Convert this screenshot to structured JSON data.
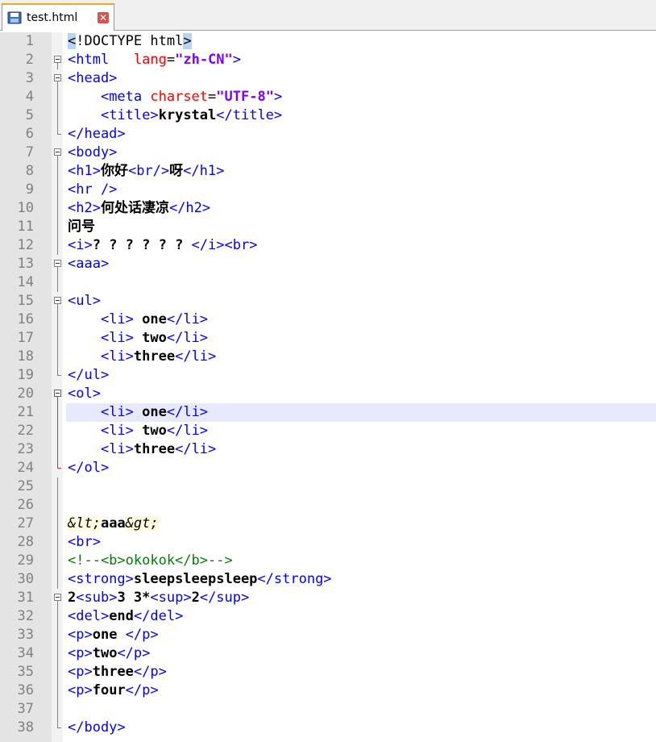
{
  "tab": {
    "title": "test.html",
    "close": "✕"
  },
  "icons": {
    "file": "save-disk-icon",
    "close": "close-icon"
  },
  "current_line": 21,
  "lines": [
    {
      "n": "1",
      "fold": "",
      "tokens": [
        [
          "hl",
          "<"
        ],
        [
          "plain",
          "!DOCTYPE html"
        ],
        [
          "hl",
          ">"
        ]
      ]
    },
    {
      "n": "2",
      "fold": "open",
      "tokens": [
        [
          "tag",
          "<html"
        ],
        [
          "plain",
          "   "
        ],
        [
          "attr",
          "lang"
        ],
        [
          "plain",
          "="
        ],
        [
          "val",
          "\"zh-CN\""
        ],
        [
          "tag",
          ">"
        ]
      ]
    },
    {
      "n": "3",
      "fold": "open",
      "tokens": [
        [
          "tag",
          "<head>"
        ]
      ]
    },
    {
      "n": "4",
      "fold": "line",
      "tokens": [
        [
          "plain",
          "    "
        ],
        [
          "tag",
          "<meta "
        ],
        [
          "attr",
          "charset"
        ],
        [
          "plain",
          "="
        ],
        [
          "val",
          "\"UTF-8\""
        ],
        [
          "tag",
          ">"
        ]
      ]
    },
    {
      "n": "5",
      "fold": "line",
      "tokens": [
        [
          "plain",
          "    "
        ],
        [
          "tag",
          "<title>"
        ],
        [
          "txt",
          "krystal"
        ],
        [
          "tag",
          "</title>"
        ]
      ]
    },
    {
      "n": "6",
      "fold": "end",
      "tokens": [
        [
          "tag",
          "</head>"
        ]
      ]
    },
    {
      "n": "7",
      "fold": "open",
      "tokens": [
        [
          "tag",
          "<body>"
        ]
      ]
    },
    {
      "n": "8",
      "fold": "line",
      "tokens": [
        [
          "tag",
          "<h1>"
        ],
        [
          "txt",
          "你好"
        ],
        [
          "tag",
          "<br/>"
        ],
        [
          "txt",
          "呀"
        ],
        [
          "tag",
          "</h1>"
        ]
      ]
    },
    {
      "n": "9",
      "fold": "line",
      "tokens": [
        [
          "tag",
          "<hr />"
        ]
      ]
    },
    {
      "n": "10",
      "fold": "line",
      "tokens": [
        [
          "tag",
          "<h2>"
        ],
        [
          "txt",
          "何处话凄凉"
        ],
        [
          "tag",
          "</h2>"
        ]
      ]
    },
    {
      "n": "11",
      "fold": "line",
      "tokens": [
        [
          "txt",
          "问号"
        ]
      ]
    },
    {
      "n": "12",
      "fold": "line",
      "tokens": [
        [
          "tag",
          "<i>"
        ],
        [
          "txt",
          "? ? ? ? ? ? "
        ],
        [
          "tag",
          "</i><br>"
        ]
      ]
    },
    {
      "n": "13",
      "fold": "open",
      "tokens": [
        [
          "tag",
          "<aaa>"
        ]
      ]
    },
    {
      "n": "14",
      "fold": "line",
      "tokens": []
    },
    {
      "n": "15",
      "fold": "open",
      "tokens": [
        [
          "tag",
          "<ul>"
        ]
      ]
    },
    {
      "n": "16",
      "fold": "line",
      "tokens": [
        [
          "plain",
          "    "
        ],
        [
          "tag",
          "<li> "
        ],
        [
          "txt",
          "one"
        ],
        [
          "tag",
          "</li>"
        ]
      ]
    },
    {
      "n": "17",
      "fold": "line",
      "tokens": [
        [
          "plain",
          "    "
        ],
        [
          "tag",
          "<li> "
        ],
        [
          "txt",
          "two"
        ],
        [
          "tag",
          "</li>"
        ]
      ]
    },
    {
      "n": "18",
      "fold": "line",
      "tokens": [
        [
          "plain",
          "    "
        ],
        [
          "tag",
          "<li>"
        ],
        [
          "txt",
          "three"
        ],
        [
          "tag",
          "</li>"
        ]
      ]
    },
    {
      "n": "19",
      "fold": "end",
      "tokens": [
        [
          "tag",
          "</ul>"
        ]
      ]
    },
    {
      "n": "20",
      "fold": "open-red",
      "tokens": [
        [
          "tag",
          "<ol>"
        ]
      ]
    },
    {
      "n": "21",
      "fold": "line-red",
      "tokens": [
        [
          "plain",
          "    "
        ],
        [
          "tag",
          "<li> "
        ],
        [
          "txt",
          "one"
        ],
        [
          "tag",
          "</li>"
        ]
      ]
    },
    {
      "n": "22",
      "fold": "line-red",
      "tokens": [
        [
          "plain",
          "    "
        ],
        [
          "tag",
          "<li> "
        ],
        [
          "txt",
          "two"
        ],
        [
          "tag",
          "</li>"
        ]
      ]
    },
    {
      "n": "23",
      "fold": "line-red",
      "tokens": [
        [
          "plain",
          "    "
        ],
        [
          "tag",
          "<li>"
        ],
        [
          "txt",
          "three"
        ],
        [
          "tag",
          "</li>"
        ]
      ]
    },
    {
      "n": "24",
      "fold": "end-red",
      "tokens": [
        [
          "tag",
          "</ol>"
        ]
      ]
    },
    {
      "n": "25",
      "fold": "line",
      "tokens": []
    },
    {
      "n": "26",
      "fold": "line",
      "tokens": []
    },
    {
      "n": "27",
      "fold": "line",
      "tokens": [
        [
          "ent",
          "&lt;"
        ],
        [
          "txt",
          "aaa"
        ],
        [
          "ent",
          "&gt;"
        ]
      ]
    },
    {
      "n": "28",
      "fold": "line",
      "tokens": [
        [
          "tag",
          "<br>"
        ]
      ]
    },
    {
      "n": "29",
      "fold": "line",
      "tokens": [
        [
          "cmt",
          "<!--<b>okokok</b>-->"
        ]
      ]
    },
    {
      "n": "30",
      "fold": "line",
      "tokens": [
        [
          "tag",
          "<strong>"
        ],
        [
          "txt",
          "sleepsleepsleep"
        ],
        [
          "tag",
          "</strong>"
        ]
      ]
    },
    {
      "n": "31",
      "fold": "open",
      "tokens": [
        [
          "txt",
          "2"
        ],
        [
          "tag",
          "<sub>"
        ],
        [
          "txt",
          "3 3*"
        ],
        [
          "tag",
          "<sup>"
        ],
        [
          "txt",
          "2"
        ],
        [
          "tag",
          "</sup>"
        ]
      ]
    },
    {
      "n": "32",
      "fold": "line",
      "tokens": [
        [
          "tag",
          "<del>"
        ],
        [
          "txt",
          "end"
        ],
        [
          "tag",
          "</del>"
        ]
      ]
    },
    {
      "n": "33",
      "fold": "line",
      "tokens": [
        [
          "tag",
          "<p>"
        ],
        [
          "txt",
          "one "
        ],
        [
          "tag",
          "</p>"
        ]
      ]
    },
    {
      "n": "34",
      "fold": "line",
      "tokens": [
        [
          "tag",
          "<p>"
        ],
        [
          "txt",
          "two"
        ],
        [
          "tag",
          "</p>"
        ]
      ]
    },
    {
      "n": "35",
      "fold": "line",
      "tokens": [
        [
          "tag",
          "<p>"
        ],
        [
          "txt",
          "three"
        ],
        [
          "tag",
          "</p>"
        ]
      ]
    },
    {
      "n": "36",
      "fold": "line",
      "tokens": [
        [
          "tag",
          "<p>"
        ],
        [
          "txt",
          "four"
        ],
        [
          "tag",
          "</p>"
        ]
      ]
    },
    {
      "n": "37",
      "fold": "line",
      "tokens": []
    },
    {
      "n": "38",
      "fold": "end",
      "tokens": [
        [
          "tag",
          "</body>"
        ]
      ]
    }
  ]
}
